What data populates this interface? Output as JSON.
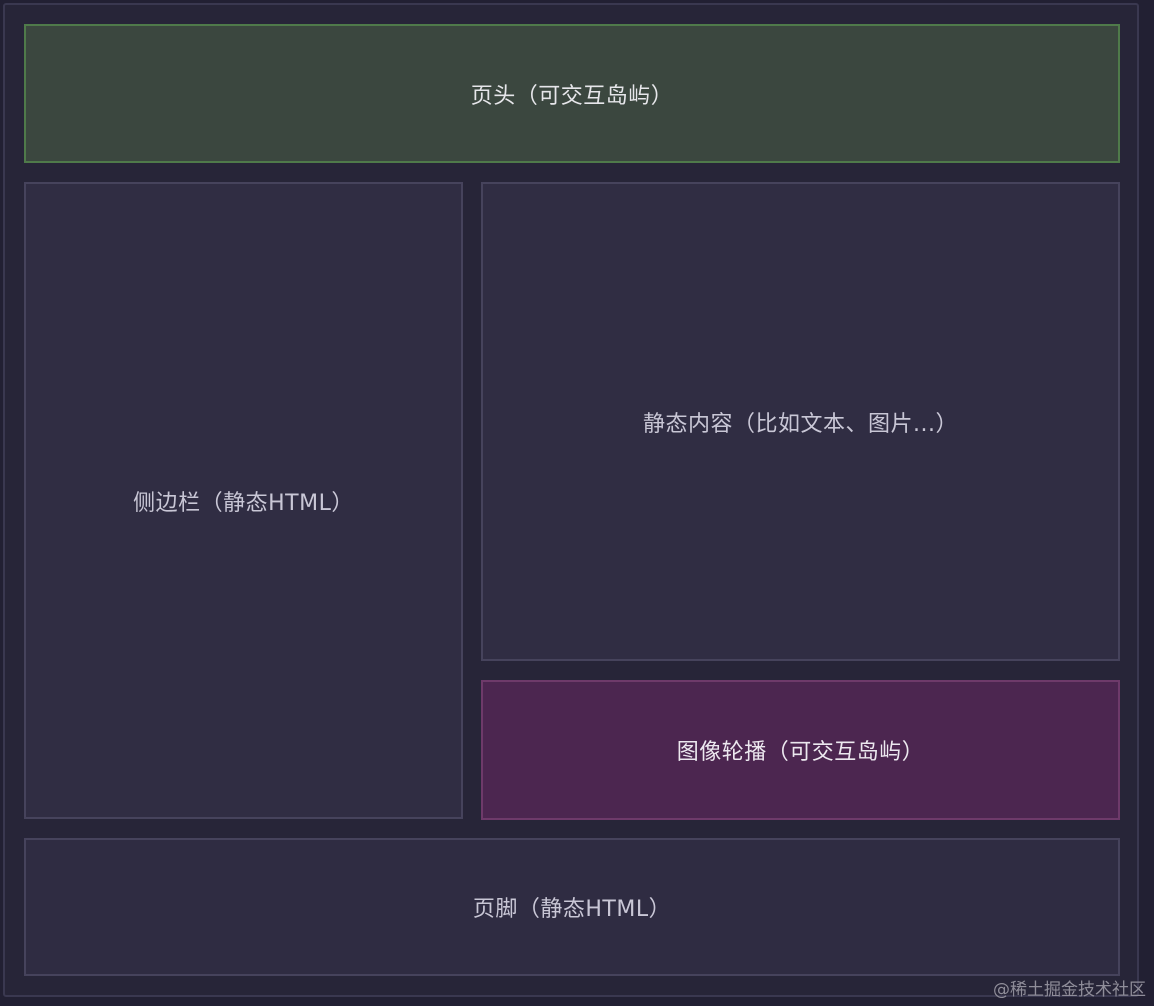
{
  "diagram": {
    "header": {
      "label": "页头（可交互岛屿）",
      "color": "#3b473f"
    },
    "sidebar": {
      "label": "侧边栏（静态HTML）",
      "color": "#302d43"
    },
    "static_content": {
      "label": "静态内容（比如文本、图片...）",
      "color": "#302d43"
    },
    "carousel": {
      "label": "图像轮播（可交互岛屿）",
      "color": "#4c2650"
    },
    "footer": {
      "label": "页脚（静态HTML）",
      "color": "#2f2c42"
    }
  },
  "watermark": "@稀土掘金技术社区"
}
